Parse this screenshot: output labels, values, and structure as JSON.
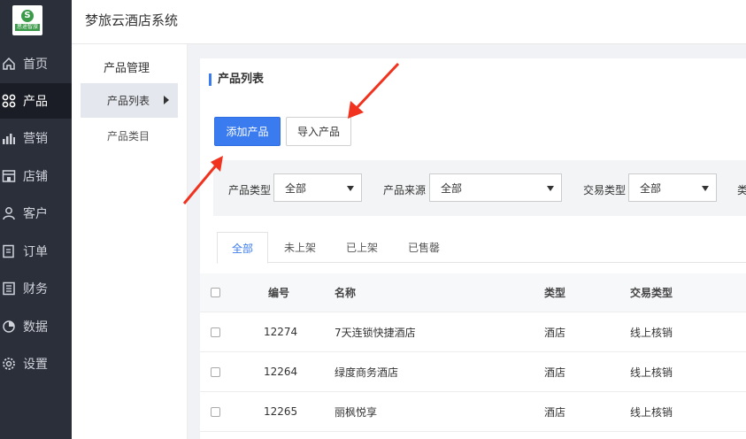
{
  "app": {
    "title": "梦旅云酒店系统",
    "logo_text": "思途智旅"
  },
  "nav": [
    {
      "label": "首页",
      "icon": "home-icon"
    },
    {
      "label": "产品",
      "icon": "grid-icon",
      "active": true
    },
    {
      "label": "营销",
      "icon": "bar-chart-icon"
    },
    {
      "label": "店铺",
      "icon": "store-icon"
    },
    {
      "label": "客户",
      "icon": "user-icon"
    },
    {
      "label": "订单",
      "icon": "order-icon"
    },
    {
      "label": "财务",
      "icon": "finance-icon"
    },
    {
      "label": "数据",
      "icon": "pie-chart-icon"
    },
    {
      "label": "设置",
      "icon": "gear-icon"
    }
  ],
  "subnav": {
    "title": "产品管理",
    "items": [
      {
        "label": "产品列表",
        "active": true
      },
      {
        "label": "产品类目"
      }
    ]
  },
  "panel": {
    "title": "产品列表",
    "add_button": "添加产品",
    "import_button": "导入产品"
  },
  "filters": [
    {
      "label": "产品类型",
      "value": "全部"
    },
    {
      "label": "产品来源",
      "value": "全部"
    },
    {
      "label": "交易类型",
      "value": "全部"
    }
  ],
  "filter_overflow_text": "类",
  "tabs": [
    "全部",
    "未上架",
    "已上架",
    "已售罄"
  ],
  "table": {
    "columns": [
      "编号",
      "名称",
      "类型",
      "交易类型"
    ],
    "rows": [
      {
        "id": "12274",
        "name": "7天连锁快捷酒店",
        "type": "酒店",
        "trade": "线上核销"
      },
      {
        "id": "12264",
        "name": "绿度商务酒店",
        "type": "酒店",
        "trade": "线上核销"
      },
      {
        "id": "12265",
        "name": "丽枫悦享",
        "type": "酒店",
        "trade": "线上核销"
      }
    ]
  },
  "colors": {
    "accent": "#3a7bf0",
    "nav_bg": "#2b2f3a",
    "annotation": "#f0321e"
  }
}
